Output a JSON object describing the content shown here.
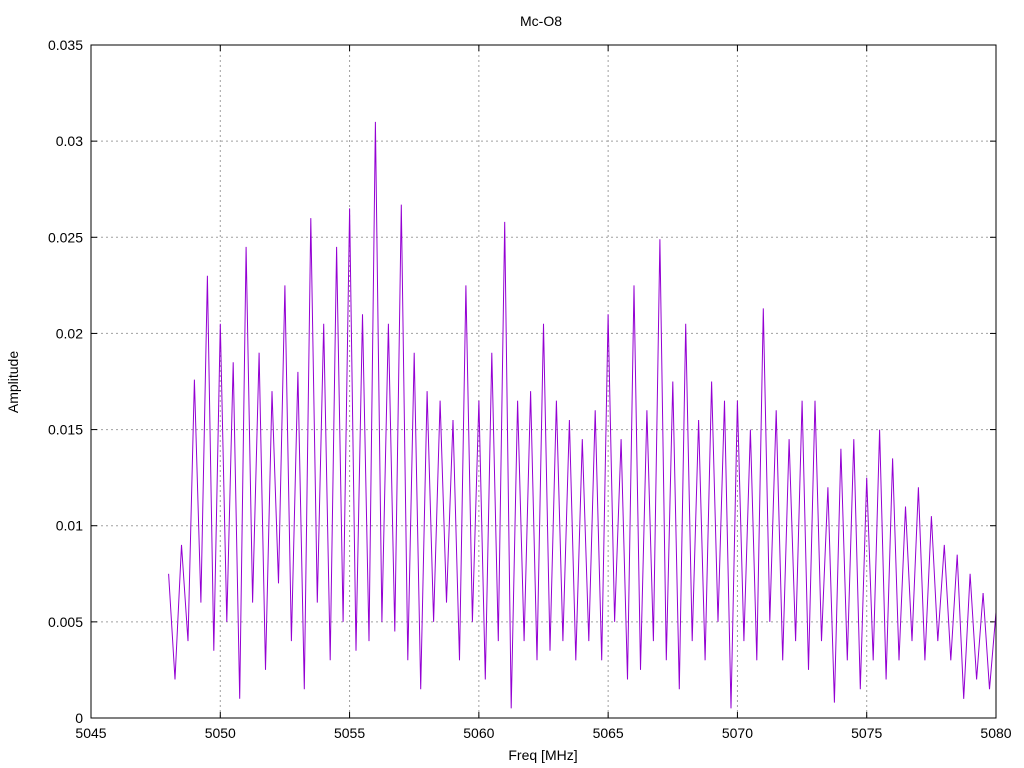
{
  "chart_data": {
    "type": "line",
    "title": "Mc-O8",
    "xlabel": "Freq [MHz]",
    "ylabel": "Amplitude",
    "xlim": [
      5045,
      5080
    ],
    "ylim": [
      0,
      0.035
    ],
    "grid": true,
    "xticks": [
      "5045",
      "5050",
      "5055",
      "5060",
      "5065",
      "5070",
      "5075",
      "5080"
    ],
    "yticks": [
      "0",
      "0.005",
      "0.01",
      "0.015",
      "0.02",
      "0.025",
      "0.03",
      "0.035"
    ],
    "series": [
      {
        "name": "Amplitude",
        "color": "#9400d3",
        "x_start": 5048,
        "x_step": 0.25,
        "values": [
          0.0075,
          0.002,
          0.009,
          0.004,
          0.0176,
          0.006,
          0.023,
          0.0035,
          0.0205,
          0.005,
          0.0185,
          0.001,
          0.0245,
          0.006,
          0.019,
          0.0025,
          0.017,
          0.007,
          0.0225,
          0.004,
          0.018,
          0.0015,
          0.026,
          0.006,
          0.0205,
          0.003,
          0.0245,
          0.005,
          0.0265,
          0.0035,
          0.021,
          0.004,
          0.031,
          0.005,
          0.0205,
          0.0045,
          0.0267,
          0.003,
          0.019,
          0.0015,
          0.017,
          0.005,
          0.0165,
          0.006,
          0.0155,
          0.003,
          0.0225,
          0.005,
          0.0165,
          0.002,
          0.019,
          0.004,
          0.0258,
          0.0005,
          0.0165,
          0.004,
          0.017,
          0.003,
          0.0205,
          0.0035,
          0.0165,
          0.004,
          0.0155,
          0.003,
          0.0145,
          0.004,
          0.016,
          0.003,
          0.021,
          0.005,
          0.0145,
          0.002,
          0.0225,
          0.0025,
          0.016,
          0.004,
          0.0249,
          0.003,
          0.0175,
          0.0015,
          0.0205,
          0.004,
          0.0155,
          0.003,
          0.0175,
          0.005,
          0.0165,
          0.0005,
          0.0165,
          0.004,
          0.015,
          0.003,
          0.0213,
          0.005,
          0.016,
          0.003,
          0.0145,
          0.004,
          0.0165,
          0.0025,
          0.0165,
          0.004,
          0.012,
          0.0008,
          0.014,
          0.003,
          0.0145,
          0.0015,
          0.0125,
          0.003,
          0.015,
          0.002,
          0.0135,
          0.003,
          0.011,
          0.004,
          0.012,
          0.003,
          0.0105,
          0.004,
          0.009,
          0.003,
          0.0085,
          0.001,
          0.0075,
          0.002,
          0.0065,
          0.0015,
          0.0055
        ]
      }
    ]
  }
}
